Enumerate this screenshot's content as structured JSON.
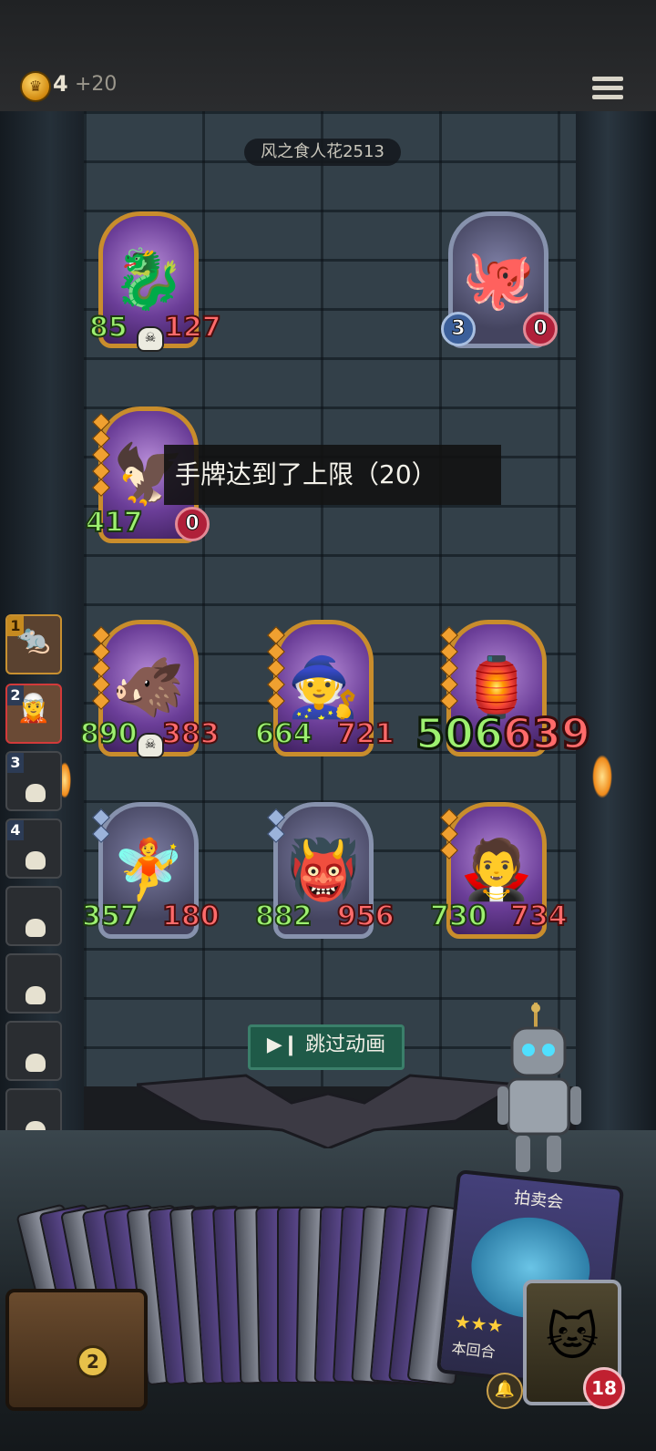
{
  "header": {
    "gold": "4",
    "gold_bonus": "+20"
  },
  "enemy": {
    "name": "风之食人花2513"
  },
  "notice": {
    "text": "手牌达到了上限（20）"
  },
  "enemy_units": [
    {
      "atk": "85",
      "hp": "127",
      "icon": "ice-dragon-portrait"
    },
    {
      "atk": "3",
      "hp": "0",
      "icon": "pirate-octopus-portrait"
    },
    {
      "atk": "417",
      "hp": "0",
      "icon": "eagle-portrait"
    }
  ],
  "player_units": [
    {
      "atk": "890",
      "hp": "383",
      "icon": "boar-portrait"
    },
    {
      "atk": "664",
      "hp": "721",
      "icon": "wizard-portrait"
    },
    {
      "atk": "506",
      "hp": "639",
      "icon": "lantern-portrait"
    },
    {
      "atk": "357",
      "hp": "180",
      "icon": "fairy-portrait"
    },
    {
      "atk": "882",
      "hp": "956",
      "icon": "red-demon-portrait"
    },
    {
      "atk": "730",
      "hp": "734",
      "icon": "vampire-portrait"
    }
  ],
  "roster": [
    "1",
    "2",
    "3",
    "4"
  ],
  "skip_button": "跳过动画",
  "auction": {
    "title": "拍卖会",
    "subtitle": "本回合"
  },
  "chest_count": "2",
  "hero_hp": "18",
  "colors": {
    "attack": "#9df070",
    "health": "#ff6b6b",
    "gold_frame": "#c98d2c"
  }
}
